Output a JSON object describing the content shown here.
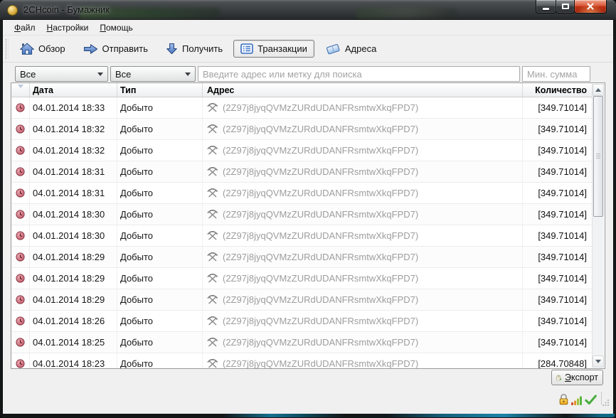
{
  "window": {
    "title": "2CHcoin - Бумажник",
    "controls": [
      "minimize",
      "maximize",
      "close"
    ]
  },
  "menu_bar": {
    "items": [
      {
        "label": "Файл"
      },
      {
        "label": "Настройки"
      },
      {
        "label": "Помощь"
      }
    ]
  },
  "toolbar": {
    "buttons": [
      {
        "label": "Обзор",
        "icon": "home-icon",
        "active": false
      },
      {
        "label": "Отправить",
        "icon": "send-arrow-icon",
        "active": false
      },
      {
        "label": "Получить",
        "icon": "receive-arrow-icon",
        "active": false
      },
      {
        "label": "Транзакции",
        "icon": "transactions-list-icon",
        "active": true
      },
      {
        "label": "Адреса",
        "icon": "address-book-icon",
        "active": false
      }
    ]
  },
  "filter_bar": {
    "date_filter": {
      "value": "Все"
    },
    "type_filter": {
      "value": "Все"
    },
    "search": {
      "value": "",
      "placeholder": "Введите адрес или метку для поиска"
    },
    "min_amount": {
      "value": "",
      "placeholder": "Мин. сумма"
    }
  },
  "transactions_table": {
    "columns": {
      "status": "",
      "date": "Дата",
      "type": "Тип",
      "address": "Адрес",
      "amount": "Количество"
    },
    "rows": [
      {
        "date": "04.01.2014 18:33",
        "type": "Добыто",
        "address": "(2Z97j8jyqQVMzZURdUDANFRsmtwXkqFPD7)",
        "amount": "[349.71014]"
      },
      {
        "date": "04.01.2014 18:32",
        "type": "Добыто",
        "address": "(2Z97j8jyqQVMzZURdUDANFRsmtwXkqFPD7)",
        "amount": "[349.71014]"
      },
      {
        "date": "04.01.2014 18:32",
        "type": "Добыто",
        "address": "(2Z97j8jyqQVMzZURdUDANFRsmtwXkqFPD7)",
        "amount": "[349.71014]"
      },
      {
        "date": "04.01.2014 18:31",
        "type": "Добыто",
        "address": "(2Z97j8jyqQVMzZURdUDANFRsmtwXkqFPD7)",
        "amount": "[349.71014]"
      },
      {
        "date": "04.01.2014 18:31",
        "type": "Добыто",
        "address": "(2Z97j8jyqQVMzZURdUDANFRsmtwXkqFPD7)",
        "amount": "[349.71014]"
      },
      {
        "date": "04.01.2014 18:30",
        "type": "Добыто",
        "address": "(2Z97j8jyqQVMzZURdUDANFRsmtwXkqFPD7)",
        "amount": "[349.71014]"
      },
      {
        "date": "04.01.2014 18:30",
        "type": "Добыто",
        "address": "(2Z97j8jyqQVMzZURdUDANFRsmtwXkqFPD7)",
        "amount": "[349.71014]"
      },
      {
        "date": "04.01.2014 18:29",
        "type": "Добыто",
        "address": "(2Z97j8jyqQVMzZURdUDANFRsmtwXkqFPD7)",
        "amount": "[349.71014]"
      },
      {
        "date": "04.01.2014 18:29",
        "type": "Добыто",
        "address": "(2Z97j8jyqQVMzZURdUDANFRsmtwXkqFPD7)",
        "amount": "[349.71014]"
      },
      {
        "date": "04.01.2014 18:29",
        "type": "Добыто",
        "address": "(2Z97j8jyqQVMzZURdUDANFRsmtwXkqFPD7)",
        "amount": "[349.71014]"
      },
      {
        "date": "04.01.2014 18:26",
        "type": "Добыто",
        "address": "(2Z97j8jyqQVMzZURdUDANFRsmtwXkqFPD7)",
        "amount": "[349.71014]"
      },
      {
        "date": "04.01.2014 18:25",
        "type": "Добыто",
        "address": "(2Z97j8jyqQVMzZURdUDANFRsmtwXkqFPD7)",
        "amount": "[349.71014]"
      },
      {
        "date": "04.01.2014 18:23",
        "type": "Добыто",
        "address": "(2Z97j8jyqQVMzZURdUDANFRsmtwXkqFPD7)",
        "amount": "[284.70848]"
      }
    ]
  },
  "export_button": {
    "label": "Экспорт",
    "icon": "export-clipboard-icon"
  },
  "status_bar": {
    "icons": [
      "lock-icon",
      "connections-signal-icon",
      "sync-check-icon"
    ]
  },
  "colors": {
    "accent_blue": "#3a6fbe",
    "frame_teal": "#1d84a8",
    "address_gray": "#9d9d9d",
    "clock_red": "#c05b6b",
    "lock_orange": "#eda31a",
    "check_green": "#49ad3e"
  }
}
